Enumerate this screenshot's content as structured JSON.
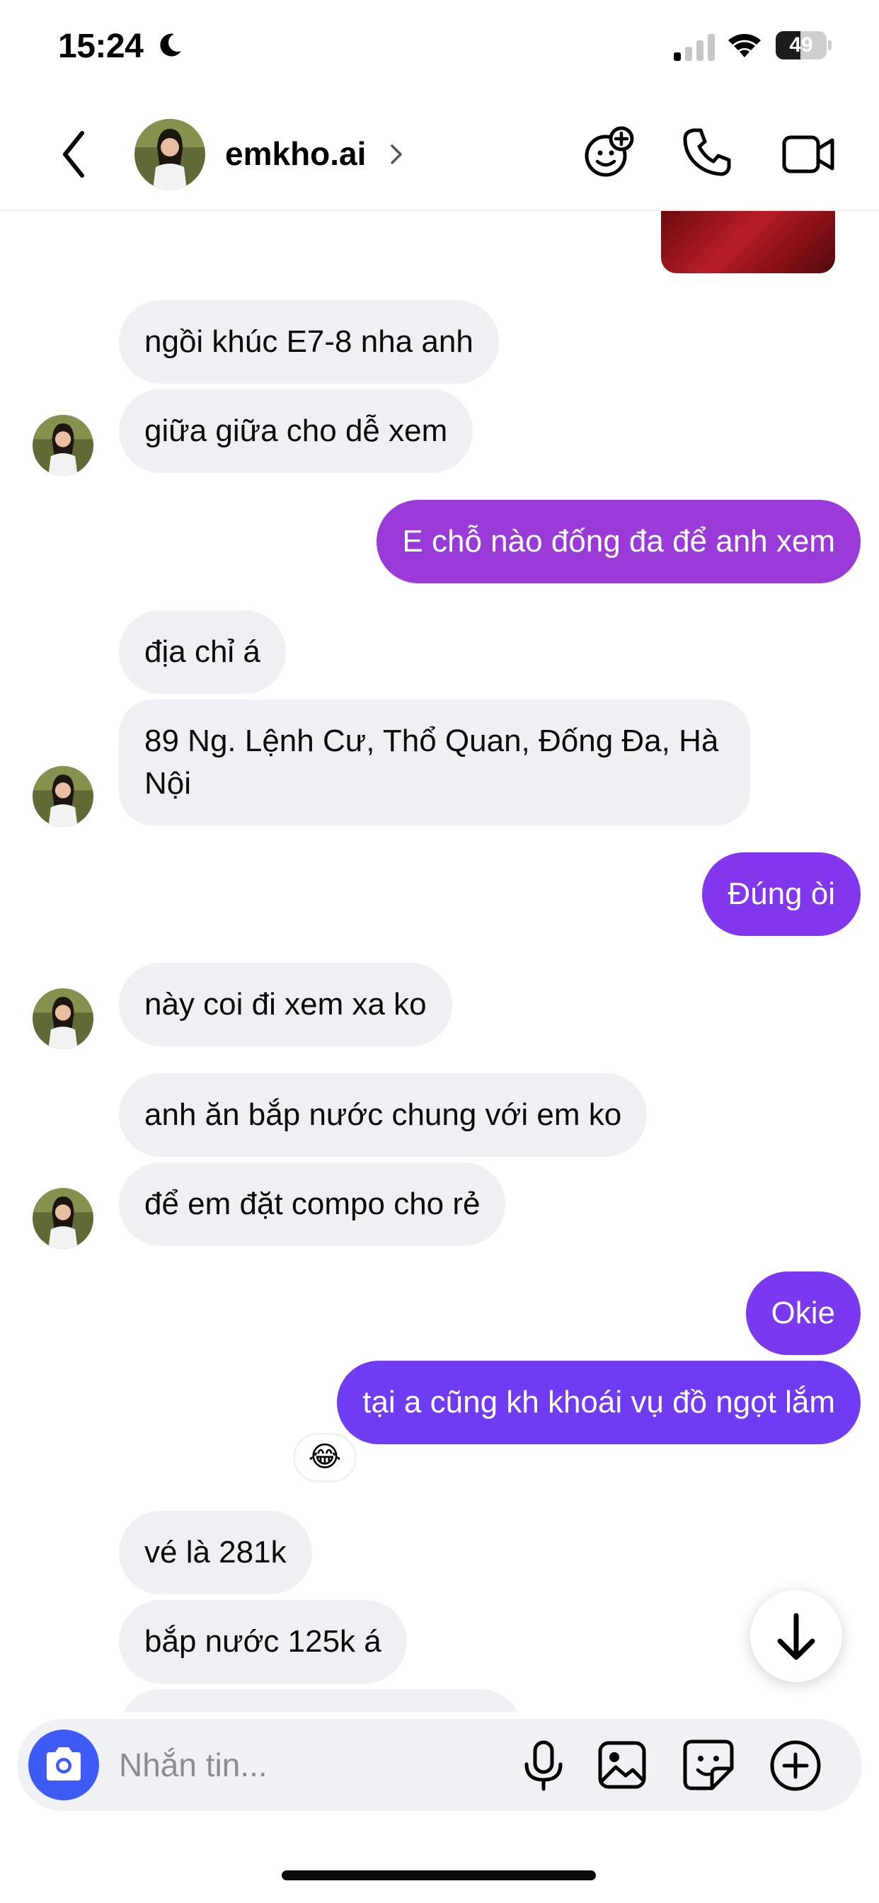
{
  "status_bar": {
    "time": "15:24",
    "battery_percent": "49",
    "battery_level": 0.49
  },
  "header": {
    "contact_name": "emkho.ai"
  },
  "messages": [
    {
      "side": "in",
      "text": "ngồi khúc E7-8 nha anh"
    },
    {
      "side": "in",
      "text": "giữa giữa cho dễ xem",
      "avatar": true
    },
    {
      "side": "out",
      "text": "E chỗ nào đống đa để anh xem"
    },
    {
      "side": "in",
      "text": "địa chỉ á"
    },
    {
      "side": "in",
      "text": "89 Ng. Lệnh Cư, Thổ Quan, Đống Đa, Hà Nội",
      "avatar": true
    },
    {
      "side": "out",
      "text": "Đúng òi"
    },
    {
      "side": "in",
      "text": "này coi đi xem xa ko",
      "avatar": true
    },
    {
      "side": "in",
      "text": "anh ăn bắp nước chung với em ko"
    },
    {
      "side": "in",
      "text": "để em đặt compo cho rẻ",
      "avatar": true
    },
    {
      "side": "out",
      "text": "Okie"
    },
    {
      "side": "out",
      "text": "tại a cũng kh khoái vụ đồ ngọt lắm",
      "reaction": "😂"
    },
    {
      "side": "in",
      "text": "vé là 281k"
    },
    {
      "side": "in",
      "text": "bắp nước 125k á"
    }
  ],
  "composer": {
    "placeholder": "Nhắn tin..."
  },
  "colors": {
    "outgoing_bubble_top": "#9a3ad8",
    "outgoing_bubble_bottom": "#6f3cf4",
    "incoming_bubble": "#eff0f3",
    "camera_button": "#3f5bf6"
  },
  "icons": {
    "back": "chevron-left-icon",
    "effects": "effects-icon",
    "call": "phone-icon",
    "video": "video-camera-icon",
    "camera": "camera-icon",
    "mic": "microphone-icon",
    "gallery": "image-icon",
    "sticker": "sticker-icon",
    "more": "plus-circle-icon",
    "scroll_down": "arrow-down-icon"
  }
}
